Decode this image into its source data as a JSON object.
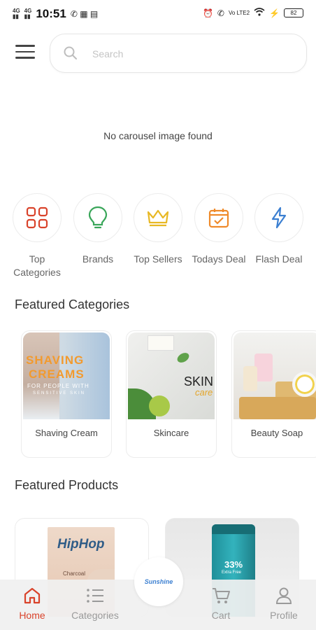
{
  "status_bar": {
    "network_1": "4G",
    "network_2": "4G",
    "time": "10:51",
    "volte": "Vo LTE2",
    "battery": "82"
  },
  "search": {
    "placeholder": "Search"
  },
  "carousel": {
    "empty_message": "No carousel image found"
  },
  "quick_links": [
    {
      "label": "Top Categories",
      "icon": "grid-icon",
      "color": "#d9432b"
    },
    {
      "label": "Brands",
      "icon": "lightbulb-icon",
      "color": "#3aa65a"
    },
    {
      "label": "Top Sellers",
      "icon": "crown-icon",
      "color": "#e8b824"
    },
    {
      "label": "Todays Deal",
      "icon": "calendar-check-icon",
      "color": "#ef8a2a"
    },
    {
      "label": "Flash Deal",
      "icon": "lightning-icon",
      "color": "#3b7fd1"
    }
  ],
  "featured_categories": {
    "title": "Featured Categories",
    "items": [
      {
        "label": "Shaving Cream",
        "image_text_1": "SHAVING",
        "image_text_2": "CREAMS",
        "image_text_3": "FOR PEOPLE WITH",
        "image_text_4": "SENSITIVE SKIN"
      },
      {
        "label": "Skincare",
        "image_text_1": "SKIN",
        "image_text_2": "care"
      },
      {
        "label": "Beauty Soap"
      }
    ]
  },
  "featured_products": {
    "title": "Featured Products",
    "items": [
      {
        "brand_text": "HipHop",
        "sub_text": "Charcoal"
      },
      {
        "badge_text": "33%",
        "badge_sub": "Extra Free"
      }
    ]
  },
  "bottom_nav": {
    "items": [
      {
        "label": "Home",
        "icon": "home-icon",
        "active": true
      },
      {
        "label": "Categories",
        "icon": "list-icon",
        "active": false
      },
      {
        "label": "Cart",
        "icon": "cart-icon",
        "active": false
      },
      {
        "label": "Profile",
        "icon": "person-icon",
        "active": false
      }
    ],
    "center_logo_text": "Sunshine"
  },
  "colors": {
    "accent": "#d9432b",
    "inactive": "#9a9a9a"
  }
}
